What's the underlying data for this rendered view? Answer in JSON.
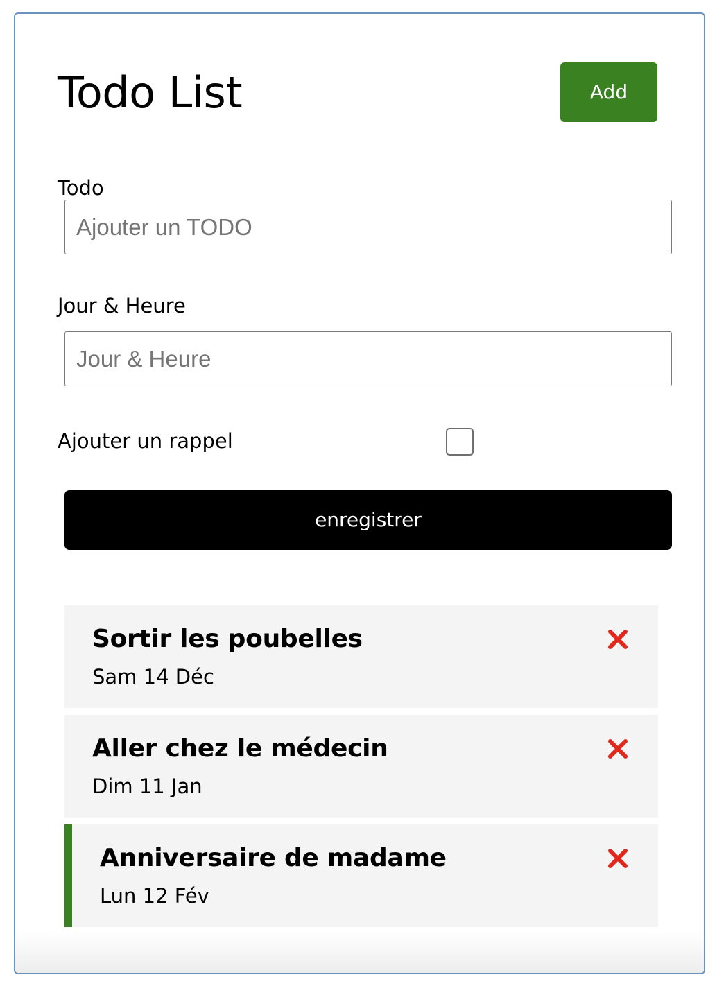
{
  "header": {
    "title": "Todo List",
    "add_label": "Add"
  },
  "form": {
    "todo_label": "Todo",
    "todo_placeholder": "Ajouter un TODO",
    "datetime_label": "Jour & Heure",
    "datetime_placeholder": "Jour & Heure",
    "reminder_label": "Ajouter un rappel",
    "reminder_checked": false,
    "save_label": "enregistrer"
  },
  "tasks": [
    {
      "title": "Sortir les poubelles",
      "date": "Sam 14 Déc",
      "reminder": false
    },
    {
      "title": "Aller chez le médecin",
      "date": "Dim 11 Jan",
      "reminder": false
    },
    {
      "title": "Anniversaire de madame",
      "date": "Lun 12 Fév",
      "reminder": true
    }
  ],
  "colors": {
    "add_button": "#3a8121",
    "save_button": "#000000",
    "reminder_border": "#3a8121",
    "delete_icon": "#e0281c",
    "task_background": "#f4f4f4",
    "container_border": "#6b93bf"
  },
  "icons": {
    "delete": "close-icon"
  }
}
